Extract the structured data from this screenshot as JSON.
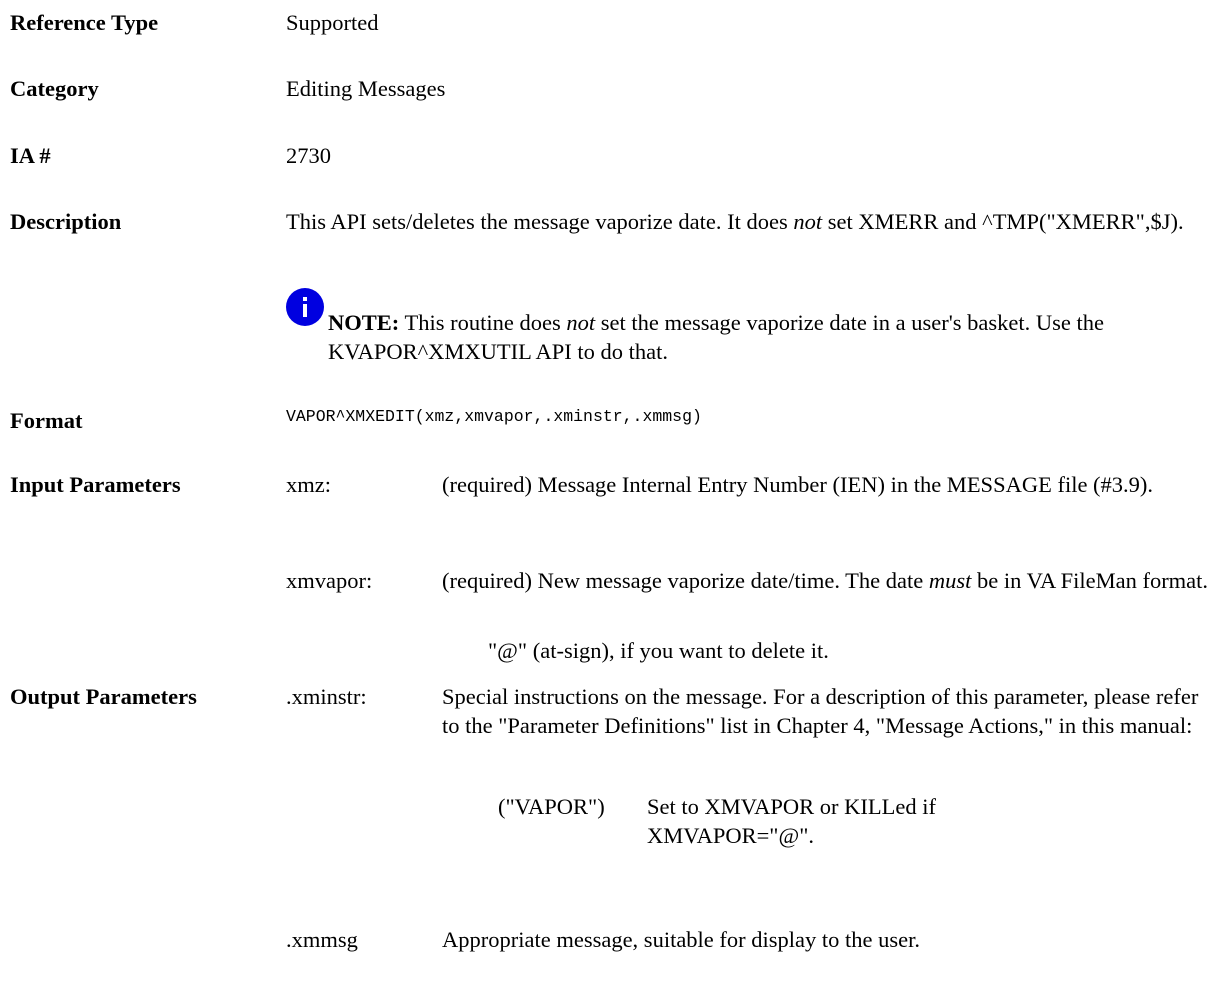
{
  "rows": {
    "reference_type": {
      "label": "Reference Type",
      "value": "Supported"
    },
    "category": {
      "label": "Category",
      "value": "Editing Messages"
    },
    "ia": {
      "label": "IA #",
      "value": "2730"
    },
    "description": {
      "label": "Description",
      "text1": "This API sets/deletes the message vaporize date. It does ",
      "em": "not",
      "text2": " set XMERR and ^TMP(\"XMERR\",$J).",
      "note": {
        "label": "NOTE:",
        "text1": " This routine does ",
        "em": "not",
        "text2": " set the message vaporize date in a user's basket. Use the KVAPOR^XMXUTIL API to do that."
      }
    },
    "format": {
      "label": "Format",
      "value": "VAPOR^XMXEDIT(xmz,xmvapor,.xminstr,.xmmsg)"
    },
    "input_parameters": {
      "label": "Input Parameters",
      "params": [
        {
          "name": "xmz:",
          "desc": "(required) Message Internal Entry Number (IEN) in the MESSAGE file (#3.9)."
        },
        {
          "name": "xmvapor:",
          "desc1": "(required) New message vaporize date/time. The date ",
          "em": "must",
          "desc2": " be in VA FileMan format.",
          "extra": "\"@\" (at-sign), if you want to delete it."
        }
      ]
    },
    "output_parameters": {
      "label": "Output Parameters",
      "params": [
        {
          "name": ".xminstr:",
          "desc": "Special instructions on the message. For a description of this parameter, please refer to the \"Parameter Definitions\" list in Chapter 4, \"Message Actions,\" in this manual:",
          "sub_key": "(\"VAPOR\")",
          "sub_value": "Set to XMVAPOR or KILLed if XMVAPOR=\"@\"."
        },
        {
          "name": ".xmmsg",
          "desc": "Appropriate message, suitable for display to the user."
        }
      ]
    }
  }
}
